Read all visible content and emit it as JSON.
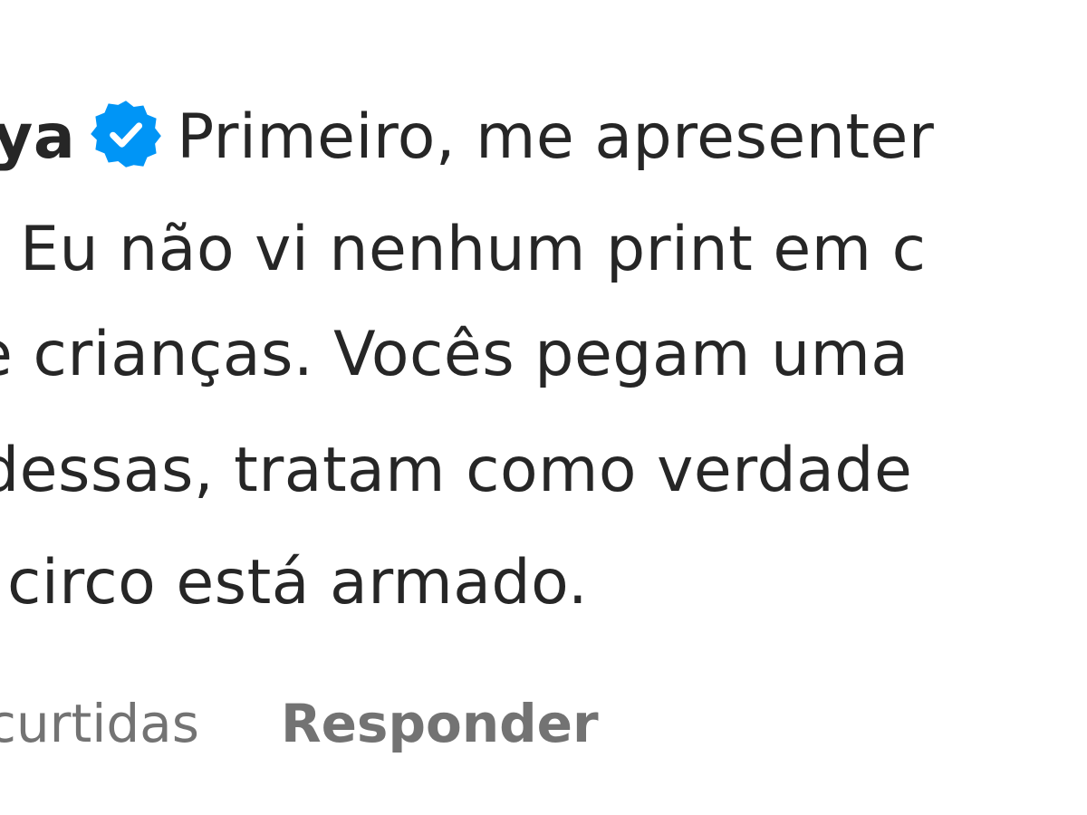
{
  "comment": {
    "username": "ya",
    "verified_icon": "verified-badge-icon",
    "lines": [
      "Primeiro, me apresenter",
      "Eu não vi nenhum print em c",
      "e crianças. Vocês pegam uma",
      "dessas, tratam como verdade",
      "circo está armado."
    ]
  },
  "actions": {
    "likes_label": "curtidas",
    "reply_label": "Responder"
  },
  "colors": {
    "text": "#262626",
    "muted": "#737373",
    "verified": "#0095f6",
    "background": "#ffffff"
  }
}
